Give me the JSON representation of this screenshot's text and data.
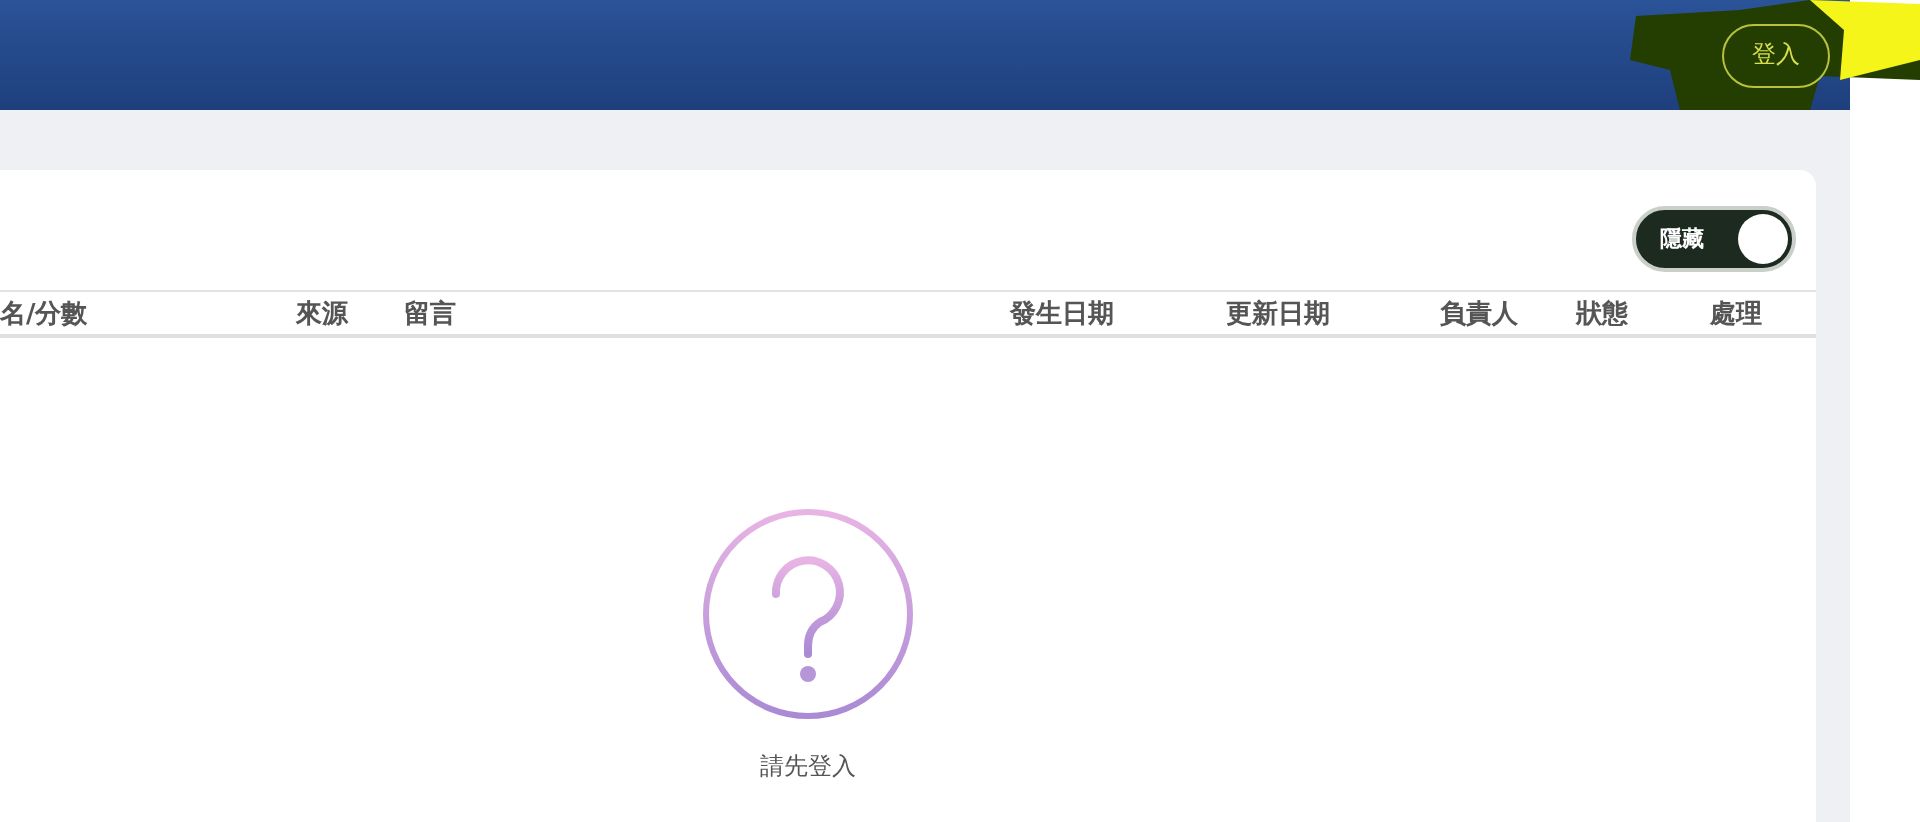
{
  "header": {
    "login_button": "登入"
  },
  "toolbar": {
    "toggle": {
      "label": "隱藏",
      "on": true
    }
  },
  "table": {
    "columns": [
      "名/分數",
      "來源",
      "留言",
      "發生日期",
      "更新日期",
      "負責人",
      "狀態",
      "處理"
    ]
  },
  "empty_state": {
    "message": "請先登入"
  }
}
